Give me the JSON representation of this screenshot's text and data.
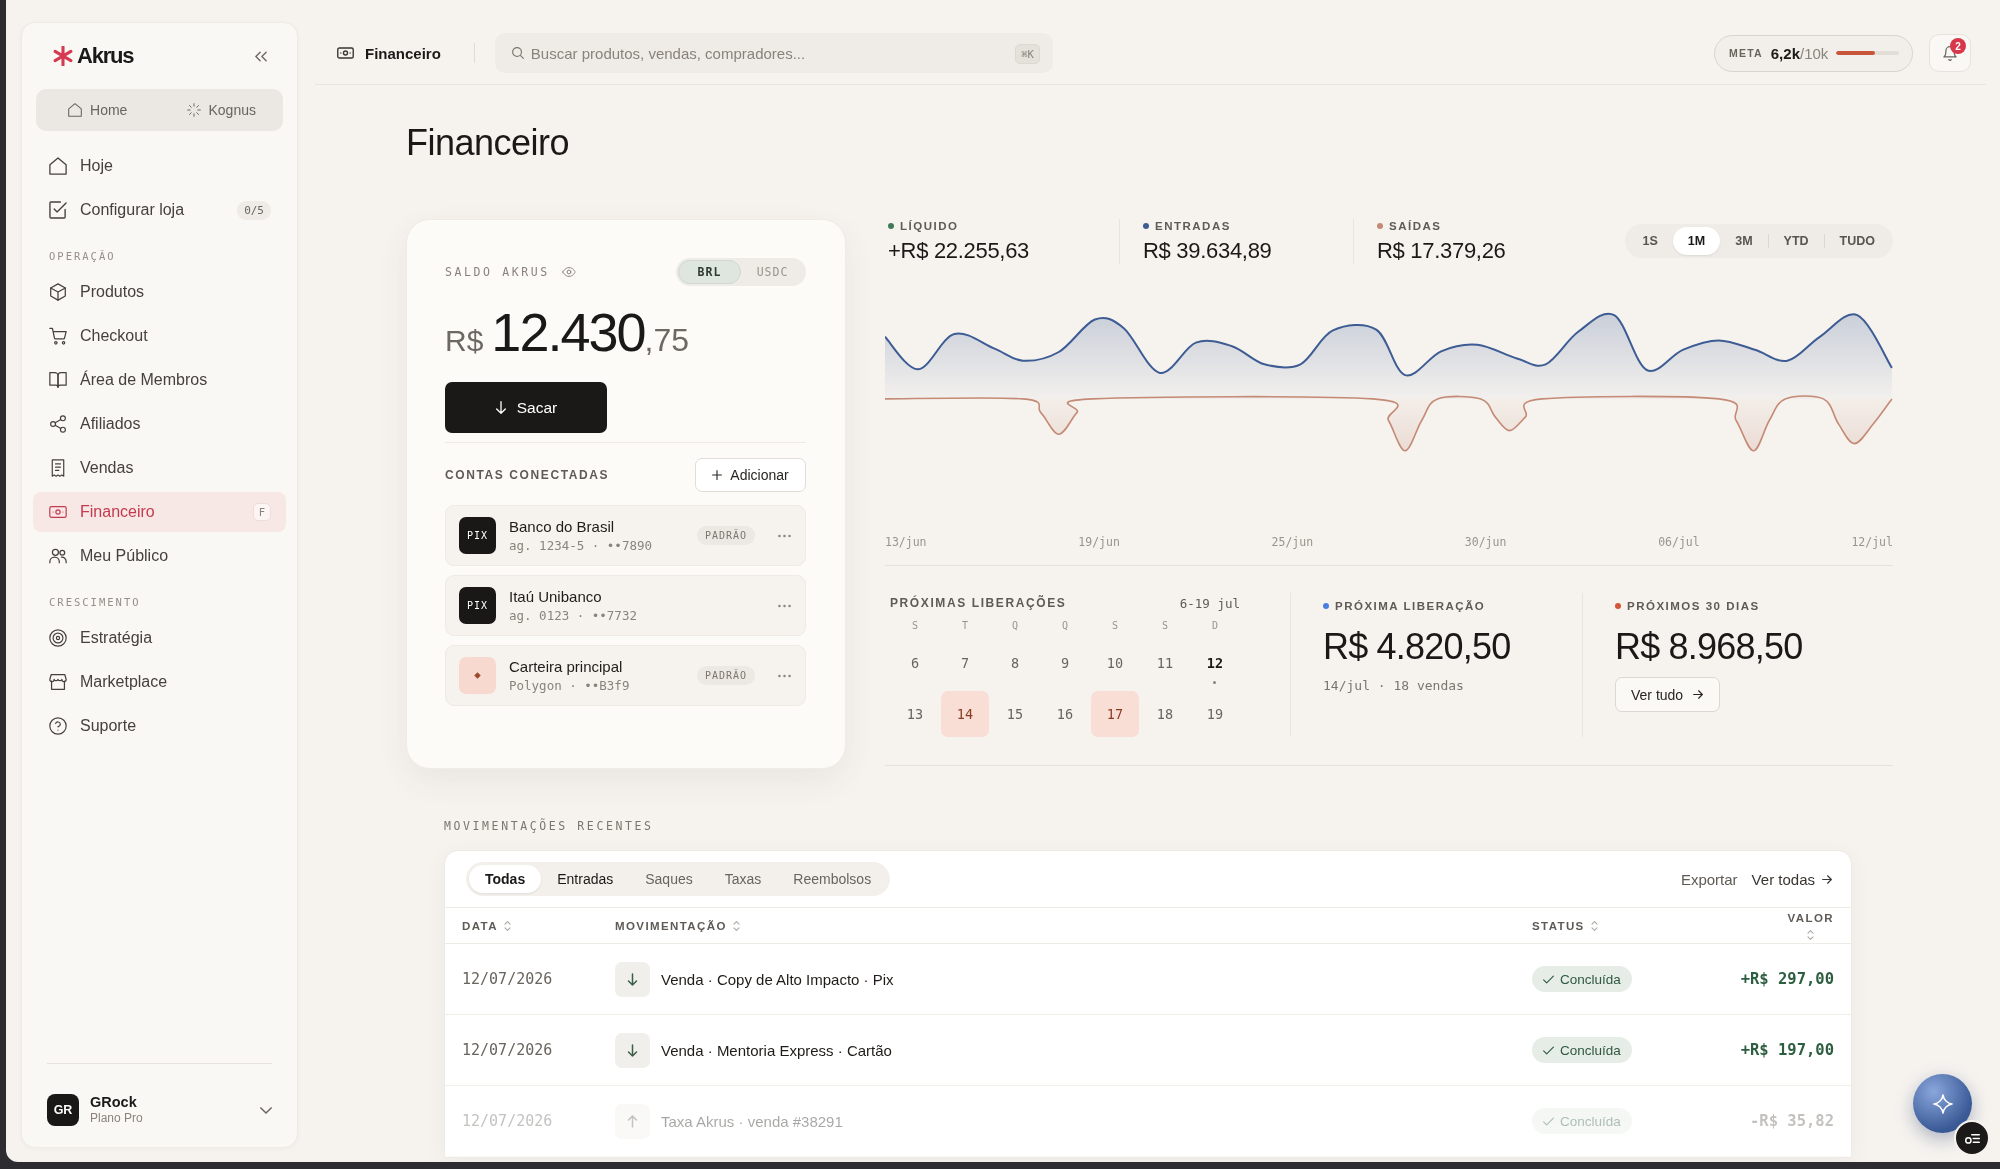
{
  "sidebar": {
    "brand": "Akrus",
    "switcher": [
      "Home",
      "Kognus"
    ],
    "sections": [
      {
        "items": [
          {
            "label": "Hoje",
            "selected": false
          },
          {
            "label": "Configurar loja",
            "selected": false,
            "count": "0/5"
          }
        ]
      },
      {
        "heading": "OPERAÇÃO",
        "items": [
          {
            "label": "Produtos",
            "selected": false
          },
          {
            "label": "Checkout",
            "selected": false
          },
          {
            "label": "Área de Membros",
            "selected": false
          },
          {
            "label": "Afiliados",
            "selected": false
          },
          {
            "label": "Vendas",
            "selected": false
          },
          {
            "label": "Financeiro",
            "selected": true,
            "shortcut": "F"
          },
          {
            "label": "Meu Público",
            "selected": false
          }
        ]
      },
      {
        "heading": "CRESCIMENTO",
        "items": [
          {
            "label": "Estratégia",
            "selected": false
          },
          {
            "label": "Marketplace",
            "selected": false
          },
          {
            "label": "Suporte",
            "selected": false
          }
        ]
      }
    ],
    "user": {
      "initials": "GR",
      "name": "GRock",
      "plan": "Plano Pro"
    }
  },
  "topbar": {
    "title": "Financeiro",
    "search": {
      "placeholder": "Buscar produtos, vendas, compradores...",
      "shortcut": "⌘K"
    },
    "goal": {
      "label": "META",
      "value": "**6,2k**/10k",
      "level": 0.62
    },
    "notifications": {
      "count": "2"
    }
  },
  "page": {
    "title": "Financeiro"
  },
  "balance": {
    "label": "SALDO AKRUS",
    "currencies": [
      {
        "label": "BRL",
        "selected": true
      },
      {
        "label": "USDC",
        "selected": false
      }
    ],
    "symbol": "R$",
    "integer": "12.430",
    "decimals": ",75",
    "withdraw": "Sacar",
    "accounts_heading": "CONTAS CONECTADAS",
    "add": "Adicionar",
    "accounts": [
      {
        "kind": "pix",
        "logo": "PIX",
        "name": "Banco do Brasil",
        "detail": "ag. 1234-5 · ••7890",
        "tag": "PADRÃO"
      },
      {
        "kind": "pix",
        "logo": "PIX",
        "name": "Itaú Unibanco",
        "detail": "ag. 0123 · ••7732"
      },
      {
        "kind": "wallet",
        "name": "Carteira principal",
        "detail": "Polygon · ••B3f9",
        "tag": "PADRÃO"
      }
    ]
  },
  "summary": {
    "stats": [
      {
        "label": "LÍQUIDO",
        "value": "+R$ 22.255,63",
        "color": "#3f7a5a"
      },
      {
        "label": "ENTRADAS",
        "value": "R$ 39.634,89",
        "color": "#3d5c94"
      },
      {
        "label": "SAÍDAS",
        "value": "R$ 17.379,26",
        "color": "#c48a76"
      }
    ],
    "periods": [
      {
        "label": "1S",
        "selected": false
      },
      {
        "label": "1M",
        "selected": true
      },
      {
        "label": "3M",
        "selected": false
      },
      {
        "label": "YTD",
        "selected": false
      },
      {
        "label": "TUDO",
        "selected": false
      }
    ],
    "chart": {
      "x_labels": [
        "13/jun",
        "19/jun",
        "25/jun",
        "30/jun",
        "06/jul",
        "12/jul"
      ]
    }
  },
  "releases": {
    "calendar": {
      "title": "PRÓXIMAS LIBERAÇÕES",
      "range": "6-19 jul",
      "weekdays": [
        "S",
        "T",
        "Q",
        "Q",
        "S",
        "S",
        "D"
      ],
      "weeks": [
        [
          {
            "day": "6",
            "release": false,
            "today": false
          },
          {
            "day": "7",
            "release": false,
            "today": false
          },
          {
            "day": "8",
            "release": false,
            "today": false
          },
          {
            "day": "9",
            "release": false,
            "today": false
          },
          {
            "day": "10",
            "release": false,
            "today": false
          },
          {
            "day": "11",
            "release": false,
            "today": false
          },
          {
            "day": "12",
            "release": false,
            "today": true
          }
        ],
        [
          {
            "day": "13",
            "release": false,
            "today": false
          },
          {
            "day": "14",
            "release": true,
            "today": false
          },
          {
            "day": "15",
            "release": false,
            "today": false
          },
          {
            "day": "16",
            "release": false,
            "today": false
          },
          {
            "day": "17",
            "release": true,
            "today": false
          },
          {
            "day": "18",
            "release": false,
            "today": false
          },
          {
            "day": "19",
            "release": false,
            "today": false
          }
        ]
      ]
    },
    "cards": [
      {
        "label": "PRÓXIMA LIBERAÇÃO",
        "color": "#4a7de0",
        "value": "R$ 4.820,50",
        "detail": "14/jul · 18 vendas"
      },
      {
        "label": "PRÓXIMOS 30 DIAS",
        "color": "#d5553a",
        "value": "R$ 8.968,50",
        "action": "Ver tudo"
      }
    ]
  },
  "movements": {
    "title": "MOVIMENTAÇÕES RECENTES",
    "filters": [
      {
        "label": "Todas",
        "selected": true,
        "hovered": false
      },
      {
        "label": "Entradas",
        "selected": false,
        "hovered": true
      },
      {
        "label": "Saques",
        "selected": false,
        "hovered": false
      },
      {
        "label": "Taxas",
        "selected": false,
        "hovered": false
      },
      {
        "label": "Reembolsos",
        "selected": false,
        "hovered": false
      }
    ],
    "export": "Exportar",
    "view_all": "Ver todas",
    "columns": [
      "DATA",
      "MOVIMENTAÇÃO",
      "STATUS",
      "VALOR"
    ],
    "rows": [
      {
        "date": "12/07/2026",
        "kind": "in",
        "description": "Venda · Copy de Alto Impacto · Pix",
        "status": "Concluída",
        "value": "+R$ 297,00"
      },
      {
        "date": "12/07/2026",
        "kind": "in",
        "description": "Venda · Mentoria Express · Cartão",
        "status": "Concluída",
        "value": "+R$ 197,00"
      },
      {
        "date": "12/07/2026",
        "kind": "out",
        "description": "Taxa Akrus · venda #38291",
        "status": "Concluída",
        "value": "-R$ 35,82"
      }
    ]
  }
}
